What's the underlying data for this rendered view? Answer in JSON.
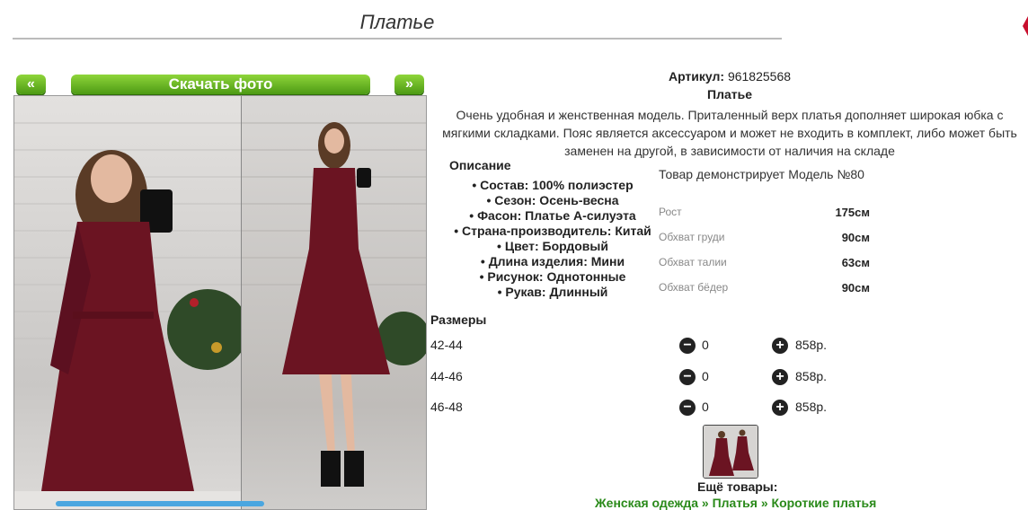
{
  "page_title": "Платье",
  "gallery": {
    "prev": "«",
    "download": "Скачать фото",
    "next": "»"
  },
  "product": {
    "article_label": "Артикул:",
    "article_value": "961825568",
    "name": "Платье",
    "description_lines": [
      "Очень удобная и женственная модель. Приталенный верх платья дополняет широкая юбка с",
      "мягкими складками. Пояс является аксессуаром и может не входить в комплект, либо может быть",
      "заменен на другой, в зависимости от наличия на складе"
    ],
    "description_heading": "Описание",
    "properties": [
      "Состав: 100% полиэстер",
      "Сезон: Осень-весна",
      "Фасон: Платье А-силуэта",
      "Страна-производитель: Китай",
      "Цвет: Бордовый",
      "Длина изделия: Мини",
      "Рисунок: Однотонные",
      "Рукав: Длинный"
    ],
    "model_note": "Товар демонстрирует Модель №80",
    "measurements": [
      {
        "label": "Рост",
        "value": "175см"
      },
      {
        "label": "Обхват груди",
        "value": "90см"
      },
      {
        "label": "Обхват талии",
        "value": "63см"
      },
      {
        "label": "Обхват бёдер",
        "value": "90см"
      }
    ]
  },
  "sizes": {
    "heading": "Размеры",
    "rows": [
      {
        "size": "42-44",
        "qty": "0",
        "price": "858р."
      },
      {
        "size": "44-46",
        "qty": "0",
        "price": "858р."
      },
      {
        "size": "46-48",
        "qty": "0",
        "price": "858р."
      }
    ]
  },
  "more": {
    "heading": "Ещё товары:",
    "crumbs": [
      "Женская одежда",
      "Платья",
      "Короткие платья"
    ],
    "separator": "»"
  },
  "colors": {
    "accent_green": "#5aa81c",
    "dress": "#6b1422",
    "link_green": "#2a8a1a"
  }
}
